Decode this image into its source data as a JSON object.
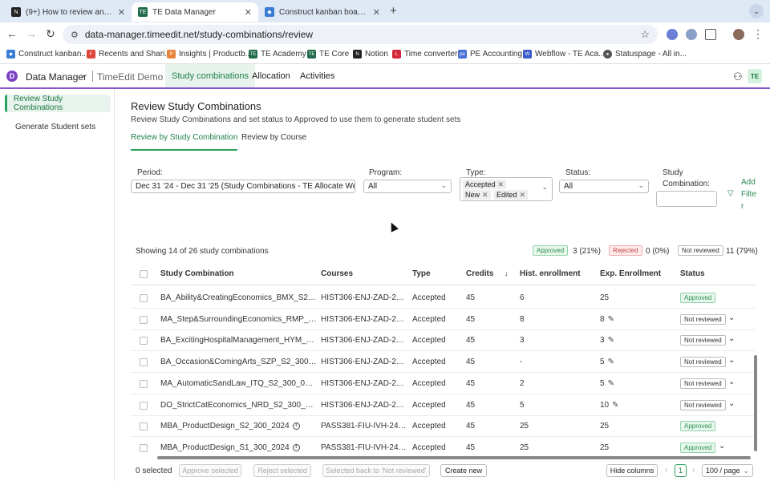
{
  "browser": {
    "tabs": [
      {
        "title": "(9+) How to review and acce",
        "favicon": "N"
      },
      {
        "title": "TE Data Manager",
        "favicon": "TE"
      },
      {
        "title": "Construct kanban board - Ap",
        "favicon": "◆"
      }
    ],
    "url": "data-manager.timeedit.net/study-combinations/review",
    "bookmarks": [
      {
        "label": "Construct kanban..."
      },
      {
        "label": "Recents and Shari..."
      },
      {
        "label": "Insights | Productb..."
      },
      {
        "label": "TE Academy"
      },
      {
        "label": "TE Core"
      },
      {
        "label": "Notion"
      },
      {
        "label": "Time converter"
      },
      {
        "label": "PE Accounting"
      },
      {
        "label": "Webflow - TE Aca..."
      },
      {
        "label": "Statuspage - All in..."
      }
    ]
  },
  "app": {
    "name": "Data Manager",
    "org": "TimeEdit Demo",
    "nav": [
      "Study combinations",
      "Allocation",
      "Activities"
    ],
    "avatar": "TE"
  },
  "sidebar": {
    "items": [
      "Review Study Combinations",
      "Generate Student sets"
    ]
  },
  "page": {
    "title": "Review Study Combinations",
    "subtitle": "Review Study Combinations and set status to Approved to use them to generate student sets",
    "tabs": [
      "Review by Study Combination",
      "Review by Course"
    ]
  },
  "filters": {
    "period_label": "Period:",
    "period_value": "Dec 31 '24 - Dec 31 '25 (Study Combinations - TE Allocate Webinar)",
    "program_label": "Program:",
    "program_value": "All",
    "type_label": "Type:",
    "type_tags": [
      "Accepted",
      "New",
      "Edited"
    ],
    "status_label": "Status:",
    "status_value": "All",
    "combo_label_1": "Study",
    "combo_label_2": "Combination:",
    "add_filter": [
      "Add",
      "Filte",
      "r"
    ]
  },
  "summary": {
    "showing": "Showing 14 of 26 study combinations",
    "approved_label": "Approved",
    "approved_count": "3 (21%)",
    "rejected_label": "Rejected",
    "rejected_count": "0 (0%)",
    "notrev_label": "Not reviewed",
    "notrev_count": "11 (79%)"
  },
  "table": {
    "headers": [
      "Study Combination",
      "Courses",
      "Type",
      "Credits",
      "Hist. enrollment",
      "Exp. Enrollment",
      "Status"
    ],
    "rows": [
      {
        "name": "BA_Ability&CreatingEconomics_BMX_S2_300_...",
        "courses": "HIST306-ENJ-ZAD-24S2,...",
        "type": "Accepted",
        "credits": "45",
        "hist": "6",
        "exp": "25",
        "status": "Approved",
        "info": false,
        "edit": false,
        "expand": false
      },
      {
        "name": "MA_Step&SurroundingEconomics_RMP_S2_3...",
        "courses": "HIST306-ENJ-ZAD-24S2,...",
        "type": "Accepted",
        "credits": "45",
        "hist": "8",
        "exp": "8",
        "status": "Not reviewed",
        "info": false,
        "edit": true,
        "expand": true
      },
      {
        "name": "BA_ExcitingHospitalManagement_HYM_S2_30...",
        "courses": "HIST306-ENJ-ZAD-24S2,...",
        "type": "Accepted",
        "credits": "45",
        "hist": "3",
        "exp": "3",
        "status": "Not reviewed",
        "info": false,
        "edit": true,
        "expand": true
      },
      {
        "name": "BA_Occasion&ComingArts_SZP_S2_300_004",
        "courses": "HIST306-ENJ-ZAD-24S2,...",
        "type": "Accepted",
        "credits": "45",
        "hist": "-",
        "exp": "5",
        "status": "Not reviewed",
        "info": true,
        "edit": true,
        "expand": true
      },
      {
        "name": "MA_AutomaticSandLaw_ITQ_S2_300_005",
        "courses": "HIST306-ENJ-ZAD-24S2,...",
        "type": "Accepted",
        "credits": "45",
        "hist": "2",
        "exp": "5",
        "status": "Not reviewed",
        "info": true,
        "edit": true,
        "expand": true
      },
      {
        "name": "DO_StrictCatEconomics_NRD_S2_300_006",
        "courses": "HIST306-ENJ-ZAD-24S2,...",
        "type": "Accepted",
        "credits": "45",
        "hist": "5",
        "exp": "10",
        "status": "Not reviewed",
        "info": true,
        "edit": true,
        "expand": true
      },
      {
        "name": "MBA_ProductDesign_S2_300_2024",
        "courses": "PASS381-FIU-IVH-24S2, I...",
        "type": "Accepted",
        "credits": "45",
        "hist": "25",
        "exp": "25",
        "status": "Approved",
        "info": true,
        "edit": false,
        "expand": false
      },
      {
        "name": "MBA_ProductDesign_S1_300_2024",
        "courses": "PASS381-FIU-IVH-24S1, I...",
        "type": "Accepted",
        "credits": "45",
        "hist": "25",
        "exp": "25",
        "status": "Approved",
        "info": true,
        "edit": false,
        "expand": true
      }
    ]
  },
  "footer": {
    "selected": "0 selected",
    "approve": "Approve selected",
    "reject": "Reject selected",
    "back": "Selected back to 'Not reviewed'",
    "create": "Create new",
    "hide_columns": "Hide columns",
    "page": "1",
    "per_page": "100 / page"
  }
}
